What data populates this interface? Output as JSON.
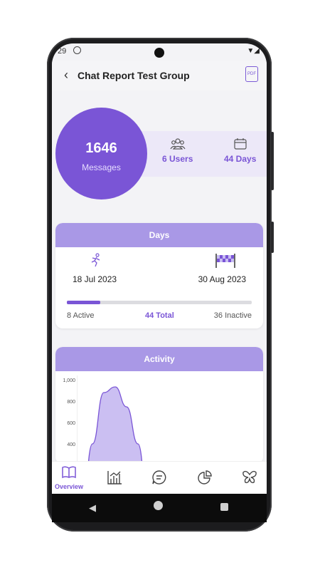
{
  "status": {
    "time": "29"
  },
  "header": {
    "title": "Chat Report Test Group",
    "pdf_label": "PDF"
  },
  "summary": {
    "messages_count": "1646",
    "messages_label": "Messages",
    "users": "6 Users",
    "days": "44 Days"
  },
  "days_card": {
    "title": "Days",
    "start_date": "18 Jul 2023",
    "end_date": "30 Aug 2023",
    "active": "8 Active",
    "total": "44 Total",
    "inactive": "36 Inactive",
    "active_fraction": 0.18
  },
  "activity_card": {
    "title": "Activity"
  },
  "chart_data": {
    "type": "area",
    "yticks": [
      "1,000",
      "800",
      "600",
      "400"
    ],
    "ylim": [
      0,
      1000
    ],
    "points": [
      [
        0,
        0
      ],
      [
        1,
        560
      ],
      [
        2,
        920
      ],
      [
        3,
        960
      ],
      [
        4,
        820
      ],
      [
        5,
        560
      ],
      [
        6,
        0
      ]
    ]
  },
  "nav": {
    "overview_label": "Overview",
    "active": "overview"
  },
  "colors": {
    "accent": "#7a55d6",
    "card_header": "#a998e6",
    "strip": "#ece8f8"
  }
}
